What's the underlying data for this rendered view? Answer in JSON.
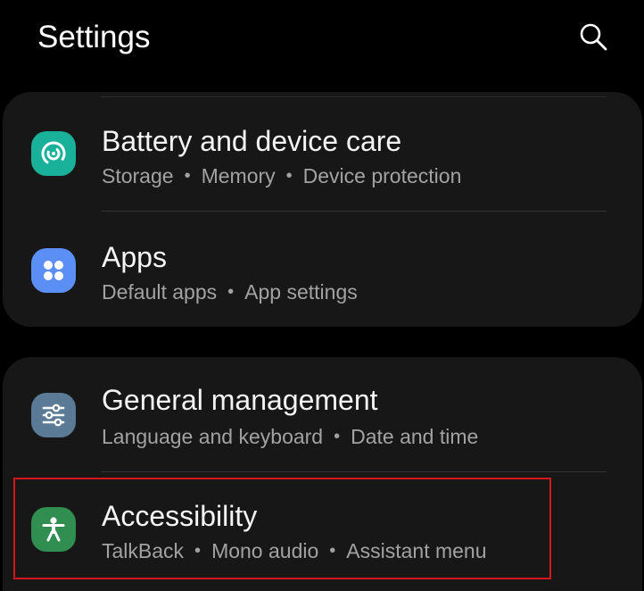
{
  "header": {
    "title": "Settings",
    "search_icon": "search-icon"
  },
  "groups": [
    {
      "items": [
        {
          "title": "Battery and device care",
          "subtitle": [
            "Storage",
            "Memory",
            "Device protection"
          ],
          "icon": "device-care-icon",
          "icon_color": "#1ab19b"
        },
        {
          "title": "Apps",
          "subtitle": [
            "Default apps",
            "App settings"
          ],
          "icon": "apps-grid-icon",
          "icon_color": "#5b8ff5"
        }
      ]
    },
    {
      "items": [
        {
          "title": "General management",
          "subtitle": [
            "Language and keyboard",
            "Date and time"
          ],
          "icon": "sliders-icon",
          "icon_color": "#5b7a95"
        },
        {
          "title": "Accessibility",
          "subtitle": [
            "TalkBack",
            "Mono audio",
            "Assistant menu"
          ],
          "icon": "accessibility-icon",
          "icon_color": "#2f8e50"
        }
      ]
    }
  ],
  "highlight_color": "#d4171c",
  "separator": "•"
}
